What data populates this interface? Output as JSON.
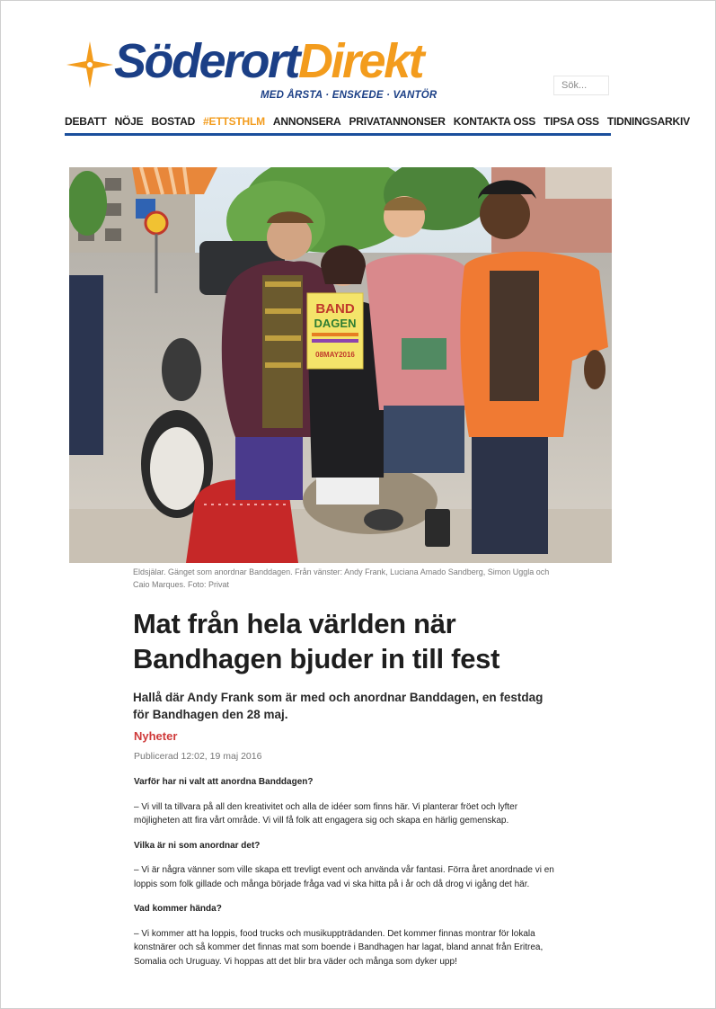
{
  "brand": {
    "name_part1": "Söderort",
    "name_part2": "Direkt",
    "tagline": "MED ÅRSTA · ENSKEDE · VANTÖR",
    "color_primary": "#1b3f86",
    "color_accent": "#f39c1d"
  },
  "search": {
    "placeholder": "Sök..."
  },
  "nav": {
    "items": [
      {
        "label": "DEBATT"
      },
      {
        "label": "NÖJE"
      },
      {
        "label": "BOSTAD"
      },
      {
        "label": "#ETTSTHLM"
      },
      {
        "label": "ANNONSERA"
      },
      {
        "label": "PRIVATANNONSER"
      },
      {
        "label": "KONTAKTA OSS"
      },
      {
        "label": "TIPSA OSS"
      },
      {
        "label": "TIDNINGSARKIV"
      }
    ]
  },
  "photo": {
    "poster_line1": "BAND",
    "poster_line2": "DAGEN",
    "poster_date": "08MAY2016",
    "caption": "Eldsjälar. Gänget som anordnar Banddagen. Från vänster: Andy Frank, Luciana Amado Sandberg, Simon Uggla och Caio Marques. Foto: Privat"
  },
  "article": {
    "headline": "Mat från hela världen när Bandhagen bjuder in till fest",
    "ingress": "Hallå där Andy Frank som är med och anordnar Banddagen, en festdag för Bandhagen den 28 maj.",
    "category": "Nyheter",
    "published": "Publicerad 12:02, 19 maj 2016",
    "q1": "Varför har ni valt att anordna Banddagen?",
    "a1": "– Vi vill ta tillvara på all den kreativitet och alla de idéer som finns här. Vi planterar fröet och lyfter möjligheten att fira vårt område. Vi vill få folk att engagera sig och skapa en härlig gemenskap.",
    "q2": "Vilka är ni som anordnar det?",
    "a2": "– Vi är några vänner som ville skapa ett trevligt event och använda vår fantasi. Förra året anordnade vi en loppis som folk gillade och många började fråga vad vi ska hitta på i år och då drog vi igång det här.",
    "q3": "Vad kommer hända?",
    "a3": "– Vi kommer att ha loppis, food trucks och musikuppträdanden. Det kommer finnas montrar för lokala konstnärer och så kommer det finnas mat som boende i Bandhagen har lagat, bland annat från Eritrea, Somalia och Uruguay. Vi hoppas att det blir bra väder och många som dyker upp!"
  }
}
